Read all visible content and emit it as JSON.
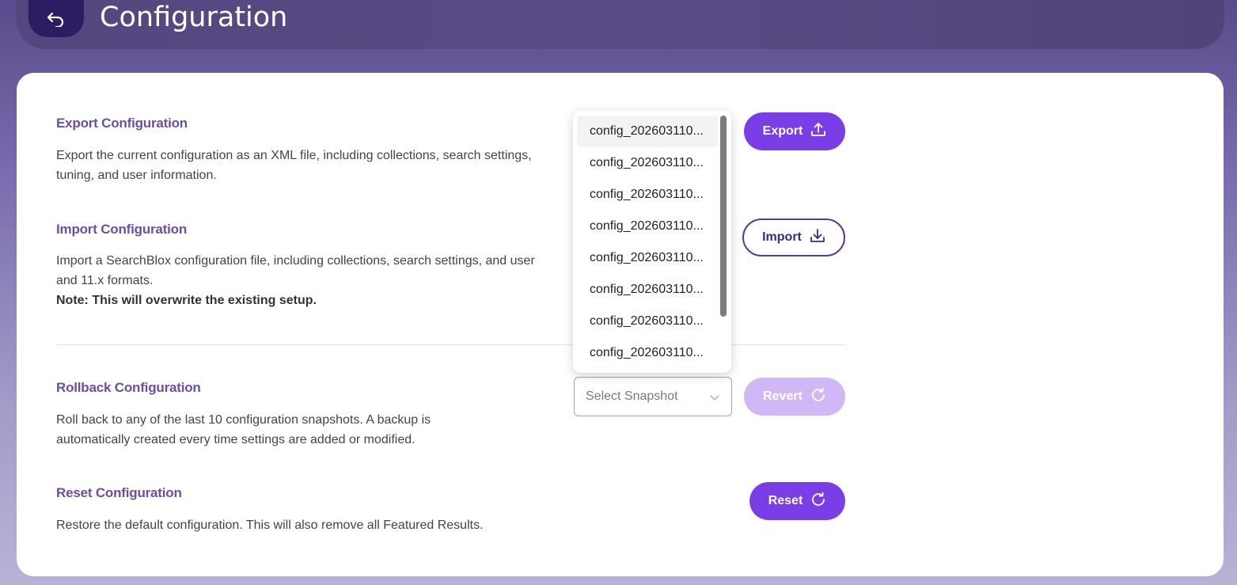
{
  "header": {
    "title": "Configuration"
  },
  "sections": {
    "export": {
      "title": "Export Configuration",
      "desc_line1": "Export the current configuration as an XML file, including collections, search settings,",
      "desc_line2": "tuning, and user information.",
      "button_label": "Export"
    },
    "import": {
      "title": "Import Configuration",
      "desc_line1": "Import a SearchBlox configuration file, including collections, search settings, and user",
      "desc_line2": "and 11.x formats.",
      "note": "Note: This will overwrite the existing setup.",
      "button_label": "Import"
    },
    "rollback": {
      "title": "Rollback Configuration",
      "desc_line1": "Roll back to any of the last 10 configuration snapshots. A backup is",
      "desc_line2": "automatically created every time settings are added or modified.",
      "select_placeholder": "Select Snapshot",
      "button_label": "Revert"
    },
    "reset": {
      "title": "Reset Configuration",
      "desc_line1": "Restore the default configuration. This will also remove all Featured Results.",
      "button_label": "Reset"
    }
  },
  "snapshot_dropdown": {
    "items": [
      "config_202603110...",
      "config_202603110...",
      "config_202603110...",
      "config_202603110...",
      "config_202603110...",
      "config_202603110...",
      "config_202603110...",
      "config_202603110..."
    ]
  },
  "colors": {
    "accent": "#7a3ee6",
    "accent_disabled": "#d0b8f6",
    "section_title": "#6a4fa6",
    "header_bg": "#55467f",
    "back_button_bg": "#2e1c63"
  },
  "icons": {
    "back": "return-arrow-icon",
    "export": "upload-icon",
    "import": "download-icon",
    "revert": "refresh-icon",
    "reset": "refresh-icon",
    "select": "chevron-down-icon"
  }
}
